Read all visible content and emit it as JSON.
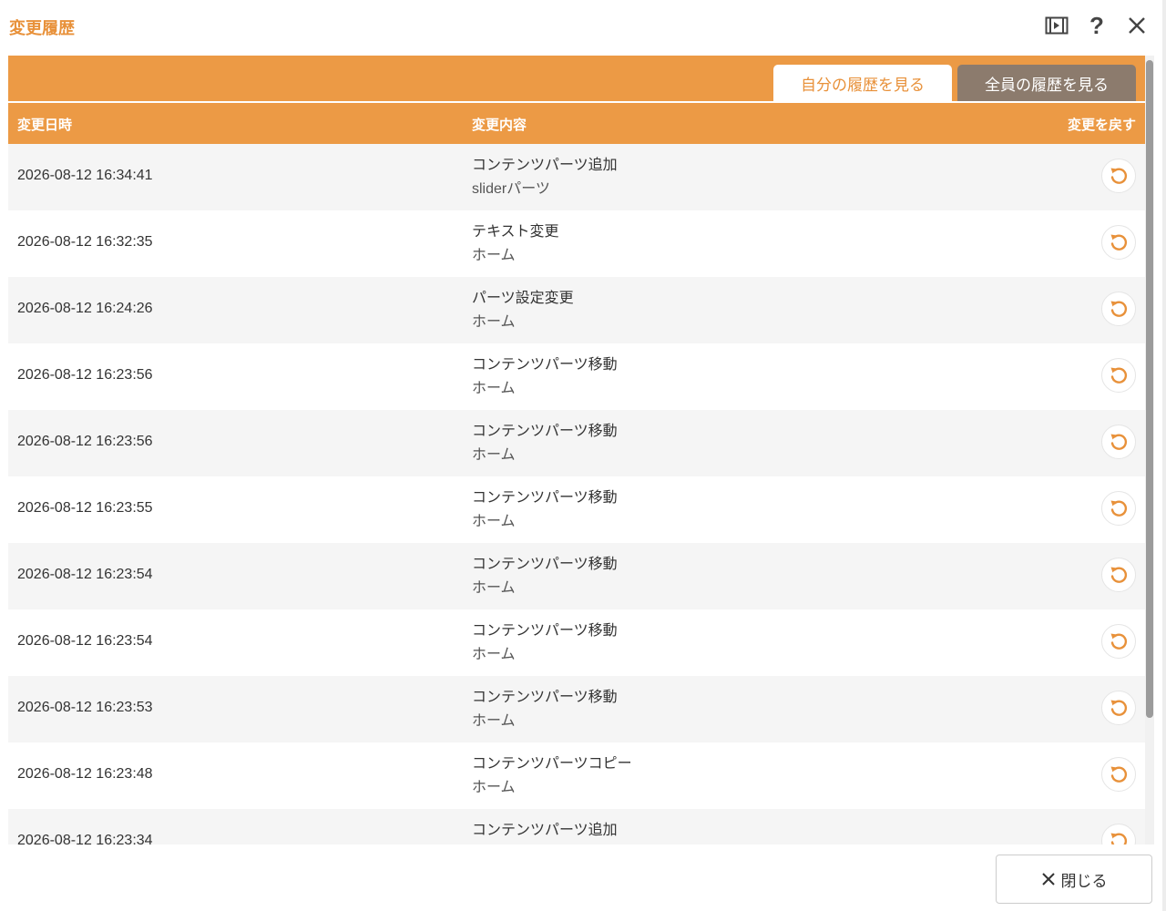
{
  "header": {
    "title": "変更履歴",
    "icons": [
      "video-icon",
      "help-icon",
      "close-icon"
    ],
    "help_glyph": "?"
  },
  "tabs": [
    {
      "label": "自分の履歴を見る",
      "active": true
    },
    {
      "label": "全員の履歴を見る",
      "active": false
    }
  ],
  "columns": {
    "date": "変更日時",
    "content": "変更内容",
    "revert": "変更を戻す"
  },
  "rows": [
    {
      "date": "2026-08-12 16:34:41",
      "action": "コンテンツパーツ追加",
      "target": "sliderパーツ"
    },
    {
      "date": "2026-08-12 16:32:35",
      "action": "テキスト変更",
      "target": "ホーム"
    },
    {
      "date": "2026-08-12 16:24:26",
      "action": "パーツ設定変更",
      "target": "ホーム"
    },
    {
      "date": "2026-08-12 16:23:56",
      "action": "コンテンツパーツ移動",
      "target": "ホーム"
    },
    {
      "date": "2026-08-12 16:23:56",
      "action": "コンテンツパーツ移動",
      "target": "ホーム"
    },
    {
      "date": "2026-08-12 16:23:55",
      "action": "コンテンツパーツ移動",
      "target": "ホーム"
    },
    {
      "date": "2026-08-12 16:23:54",
      "action": "コンテンツパーツ移動",
      "target": "ホーム"
    },
    {
      "date": "2026-08-12 16:23:54",
      "action": "コンテンツパーツ移動",
      "target": "ホーム"
    },
    {
      "date": "2026-08-12 16:23:53",
      "action": "コンテンツパーツ移動",
      "target": "ホーム"
    },
    {
      "date": "2026-08-12 16:23:48",
      "action": "コンテンツパーツコピー",
      "target": "ホーム"
    },
    {
      "date": "2026-08-12 16:23:34",
      "action": "コンテンツパーツ追加",
      "target": ""
    }
  ],
  "footer": {
    "close_label": "閉じる"
  },
  "colors": {
    "accent": "#EC9A45",
    "title": "#E8913A",
    "inactive_tab": "#8C7B6D"
  }
}
